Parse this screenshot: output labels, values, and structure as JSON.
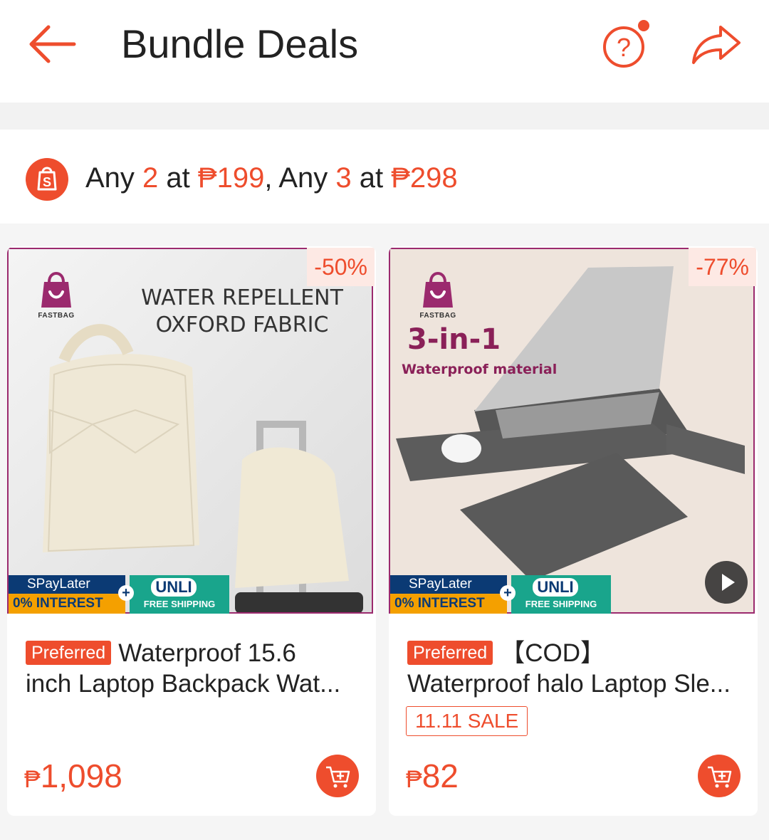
{
  "header": {
    "title": "Bundle Deals",
    "back_icon": "arrow-left-icon",
    "help_icon": "question-icon",
    "share_icon": "share-icon"
  },
  "deal": {
    "prefix": "Any ",
    "qty1": "2",
    "mid1": " at ",
    "price1": "₱199",
    "sep": ", Any ",
    "qty2": "3",
    "mid2": " at ",
    "price2": "₱298"
  },
  "products": [
    {
      "discount": "-50%",
      "brand": "FASTBAG",
      "headline_lines": [
        "WATER REPELLENT",
        "OXFORD FABRIC"
      ],
      "paylater_top": "SPayLater",
      "paylater_bottom": "0% INTEREST",
      "unli": "UNLI",
      "free_shipping": "FREE SHIPPING",
      "badge": "Preferred",
      "name_line1": "Waterproof 15.6",
      "name_line2": "inch Laptop Backpack Wat...",
      "price_currency": "₱",
      "price_value": "1,098"
    },
    {
      "discount": "-77%",
      "brand": "FASTBAG",
      "headline": "3-in-1",
      "subheadline": "Waterproof material",
      "paylater_top": "SPayLater",
      "paylater_bottom": "0% INTEREST",
      "unli": "UNLI",
      "free_shipping": "FREE SHIPPING",
      "badge": "Preferred",
      "name_line1": "【COD】",
      "name_line2": "Waterproof halo Laptop Sle...",
      "sale_tag": "11.11 SALE",
      "price_currency": "₱",
      "price_value": "82"
    }
  ],
  "colors": {
    "accent": "#ee4d2d",
    "frame": "#9b2a6e"
  }
}
